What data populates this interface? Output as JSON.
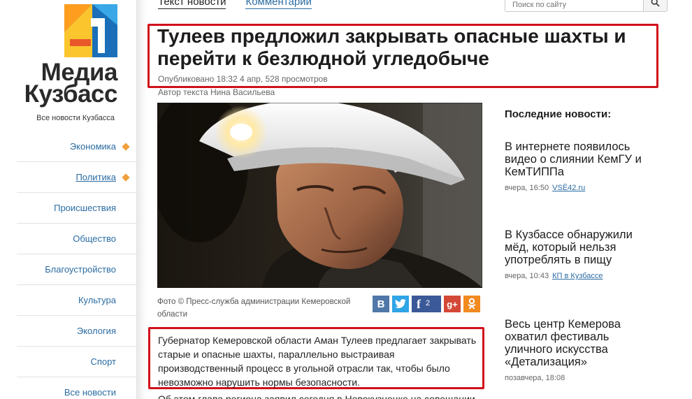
{
  "site": {
    "logo_line1": "Медиа",
    "logo_line2": "Кузбасс",
    "tagline": "Все новости Кузбасса"
  },
  "nav": {
    "items": [
      {
        "label": "Экономика",
        "marker": true,
        "active": false
      },
      {
        "label": "Политика",
        "marker": true,
        "active": true
      },
      {
        "label": "Происшествия",
        "marker": false,
        "active": false
      },
      {
        "label": "Общество",
        "marker": false,
        "active": false
      },
      {
        "label": "Благоустройство",
        "marker": false,
        "active": false
      },
      {
        "label": "Культура",
        "marker": false,
        "active": false
      },
      {
        "label": "Экология",
        "marker": false,
        "active": false
      },
      {
        "label": "Спорт",
        "marker": false,
        "active": false
      },
      {
        "label": "Все новости",
        "marker": false,
        "active": false
      }
    ]
  },
  "tabs": {
    "text": "Текст новости",
    "comments": "Комментарии"
  },
  "search": {
    "placeholder": "Поиск по сайту"
  },
  "article": {
    "title": "Тулеев предложил закрывать опасные шахты и перейти к безлюдной угледобыче",
    "meta": "Опубликовано 18:32 4 апр, 528 просмотров",
    "author": "Автор текста Нина Васильева",
    "photo_caption": "Фото © Пресс-служба администрации Кемеровской области",
    "lead": "Губернатор Кемеровской области Аман Тулеев предлагает закрывать старые и опасные шахты, параллельно выстраивая производственный процесс в угольной отрасли так, чтобы было невозможно нарушить нормы безопасности.",
    "next_line": "Об этом глава региона заявил сегодня в Новокузнецке на совещании"
  },
  "share": {
    "vk": "В",
    "twitter": "t",
    "facebook": "f",
    "facebook_count": "2",
    "google": "g+",
    "ok": "ok"
  },
  "latest": {
    "heading": "Последние новости:",
    "items": [
      {
        "title": "В интернете появилось видео о слиянии КемГУ и КемТИППа",
        "time": "вчера, 16:50",
        "source": "VSЁ42.ru"
      },
      {
        "title": "В Кузбассе обнаружили мёд, который нельзя употреблять в пищу",
        "time": "вчера, 10:43",
        "source": "КП в Кузбассе"
      },
      {
        "title": "Весь центр Кемерова охватил фестиваль уличного искусства «Детализация»",
        "time": "позавчера, 18:08",
        "source": ""
      }
    ]
  },
  "colors": {
    "link": "#2b6ca3",
    "highlight": "#d0101a",
    "marker": "#f0a03c"
  }
}
